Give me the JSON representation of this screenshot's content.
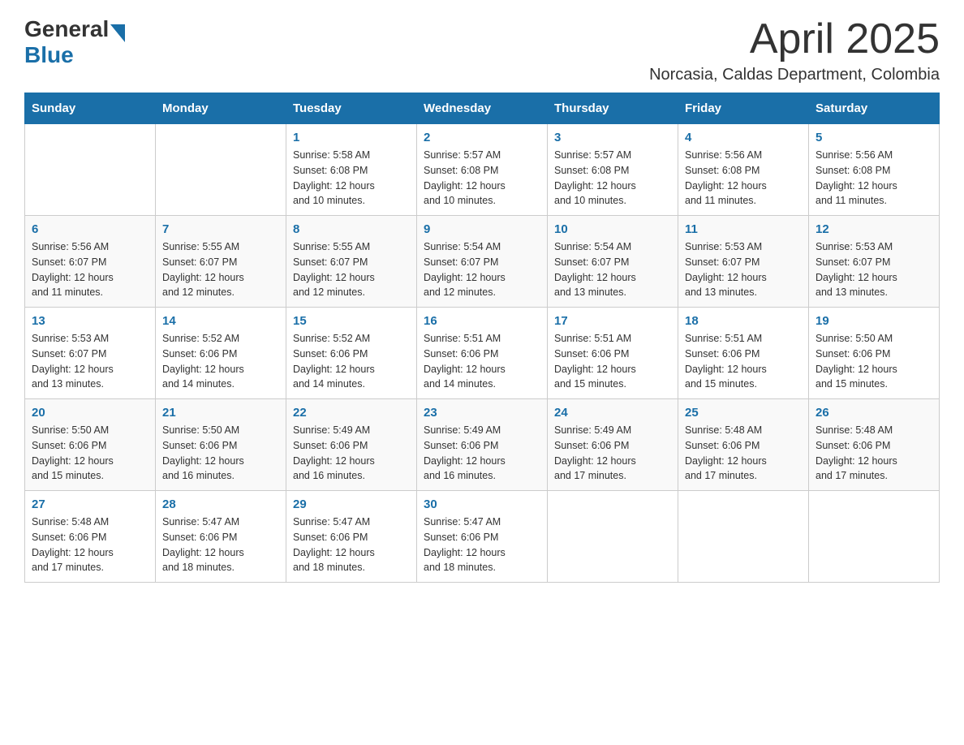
{
  "header": {
    "title": "April 2025",
    "subtitle": "Norcasia, Caldas Department, Colombia"
  },
  "logo": {
    "general": "General",
    "blue": "Blue"
  },
  "days": [
    "Sunday",
    "Monday",
    "Tuesday",
    "Wednesday",
    "Thursday",
    "Friday",
    "Saturday"
  ],
  "weeks": [
    [
      {
        "number": "",
        "detail": ""
      },
      {
        "number": "",
        "detail": ""
      },
      {
        "number": "1",
        "detail": "Sunrise: 5:58 AM\nSunset: 6:08 PM\nDaylight: 12 hours\nand 10 minutes."
      },
      {
        "number": "2",
        "detail": "Sunrise: 5:57 AM\nSunset: 6:08 PM\nDaylight: 12 hours\nand 10 minutes."
      },
      {
        "number": "3",
        "detail": "Sunrise: 5:57 AM\nSunset: 6:08 PM\nDaylight: 12 hours\nand 10 minutes."
      },
      {
        "number": "4",
        "detail": "Sunrise: 5:56 AM\nSunset: 6:08 PM\nDaylight: 12 hours\nand 11 minutes."
      },
      {
        "number": "5",
        "detail": "Sunrise: 5:56 AM\nSunset: 6:08 PM\nDaylight: 12 hours\nand 11 minutes."
      }
    ],
    [
      {
        "number": "6",
        "detail": "Sunrise: 5:56 AM\nSunset: 6:07 PM\nDaylight: 12 hours\nand 11 minutes."
      },
      {
        "number": "7",
        "detail": "Sunrise: 5:55 AM\nSunset: 6:07 PM\nDaylight: 12 hours\nand 12 minutes."
      },
      {
        "number": "8",
        "detail": "Sunrise: 5:55 AM\nSunset: 6:07 PM\nDaylight: 12 hours\nand 12 minutes."
      },
      {
        "number": "9",
        "detail": "Sunrise: 5:54 AM\nSunset: 6:07 PM\nDaylight: 12 hours\nand 12 minutes."
      },
      {
        "number": "10",
        "detail": "Sunrise: 5:54 AM\nSunset: 6:07 PM\nDaylight: 12 hours\nand 13 minutes."
      },
      {
        "number": "11",
        "detail": "Sunrise: 5:53 AM\nSunset: 6:07 PM\nDaylight: 12 hours\nand 13 minutes."
      },
      {
        "number": "12",
        "detail": "Sunrise: 5:53 AM\nSunset: 6:07 PM\nDaylight: 12 hours\nand 13 minutes."
      }
    ],
    [
      {
        "number": "13",
        "detail": "Sunrise: 5:53 AM\nSunset: 6:07 PM\nDaylight: 12 hours\nand 13 minutes."
      },
      {
        "number": "14",
        "detail": "Sunrise: 5:52 AM\nSunset: 6:06 PM\nDaylight: 12 hours\nand 14 minutes."
      },
      {
        "number": "15",
        "detail": "Sunrise: 5:52 AM\nSunset: 6:06 PM\nDaylight: 12 hours\nand 14 minutes."
      },
      {
        "number": "16",
        "detail": "Sunrise: 5:51 AM\nSunset: 6:06 PM\nDaylight: 12 hours\nand 14 minutes."
      },
      {
        "number": "17",
        "detail": "Sunrise: 5:51 AM\nSunset: 6:06 PM\nDaylight: 12 hours\nand 15 minutes."
      },
      {
        "number": "18",
        "detail": "Sunrise: 5:51 AM\nSunset: 6:06 PM\nDaylight: 12 hours\nand 15 minutes."
      },
      {
        "number": "19",
        "detail": "Sunrise: 5:50 AM\nSunset: 6:06 PM\nDaylight: 12 hours\nand 15 minutes."
      }
    ],
    [
      {
        "number": "20",
        "detail": "Sunrise: 5:50 AM\nSunset: 6:06 PM\nDaylight: 12 hours\nand 15 minutes."
      },
      {
        "number": "21",
        "detail": "Sunrise: 5:50 AM\nSunset: 6:06 PM\nDaylight: 12 hours\nand 16 minutes."
      },
      {
        "number": "22",
        "detail": "Sunrise: 5:49 AM\nSunset: 6:06 PM\nDaylight: 12 hours\nand 16 minutes."
      },
      {
        "number": "23",
        "detail": "Sunrise: 5:49 AM\nSunset: 6:06 PM\nDaylight: 12 hours\nand 16 minutes."
      },
      {
        "number": "24",
        "detail": "Sunrise: 5:49 AM\nSunset: 6:06 PM\nDaylight: 12 hours\nand 17 minutes."
      },
      {
        "number": "25",
        "detail": "Sunrise: 5:48 AM\nSunset: 6:06 PM\nDaylight: 12 hours\nand 17 minutes."
      },
      {
        "number": "26",
        "detail": "Sunrise: 5:48 AM\nSunset: 6:06 PM\nDaylight: 12 hours\nand 17 minutes."
      }
    ],
    [
      {
        "number": "27",
        "detail": "Sunrise: 5:48 AM\nSunset: 6:06 PM\nDaylight: 12 hours\nand 17 minutes."
      },
      {
        "number": "28",
        "detail": "Sunrise: 5:47 AM\nSunset: 6:06 PM\nDaylight: 12 hours\nand 18 minutes."
      },
      {
        "number": "29",
        "detail": "Sunrise: 5:47 AM\nSunset: 6:06 PM\nDaylight: 12 hours\nand 18 minutes."
      },
      {
        "number": "30",
        "detail": "Sunrise: 5:47 AM\nSunset: 6:06 PM\nDaylight: 12 hours\nand 18 minutes."
      },
      {
        "number": "",
        "detail": ""
      },
      {
        "number": "",
        "detail": ""
      },
      {
        "number": "",
        "detail": ""
      }
    ]
  ]
}
